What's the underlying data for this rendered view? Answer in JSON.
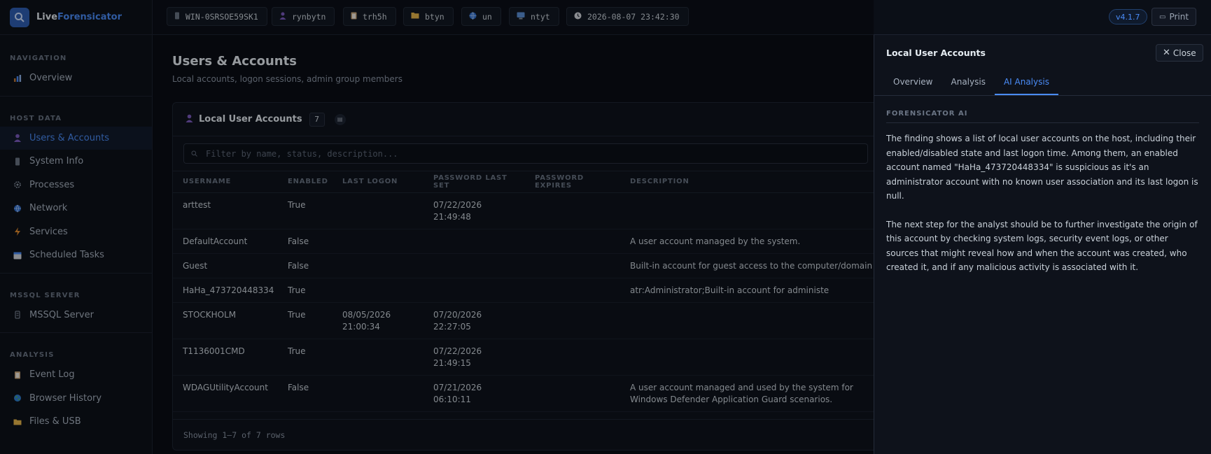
{
  "brand": {
    "name_part1": "Live",
    "name_part2": "Forensicator"
  },
  "sidebar": {
    "sections": [
      {
        "title": "NAVIGATION",
        "items": [
          {
            "label": "Overview",
            "icon": "chart-icon"
          }
        ]
      },
      {
        "title": "HOST DATA",
        "items": [
          {
            "label": "Users & Accounts",
            "icon": "user-icon",
            "active": true
          },
          {
            "label": "System Info",
            "icon": "device-icon"
          },
          {
            "label": "Processes",
            "icon": "gear-icon"
          },
          {
            "label": "Network",
            "icon": "globe-icon"
          },
          {
            "label": "Services",
            "icon": "bolt-icon"
          },
          {
            "label": "Scheduled Tasks",
            "icon": "calendar-icon"
          }
        ]
      },
      {
        "title": "MSSQL SERVER",
        "items": [
          {
            "label": "MSSQL Server",
            "icon": "database-icon"
          }
        ]
      },
      {
        "title": "ANALYSIS",
        "items": [
          {
            "label": "Event Log",
            "icon": "clipboard-icon"
          },
          {
            "label": "Browser History",
            "icon": "earth-icon"
          },
          {
            "label": "Files & USB",
            "icon": "folder-icon"
          }
        ]
      }
    ]
  },
  "topbar": {
    "chips": [
      {
        "icon": "device-icon",
        "text": "WIN-0SRSOE59SK1"
      },
      {
        "icon": "user-icon",
        "text": "rynbytn"
      },
      {
        "icon": "clipboard-icon",
        "text": "trh5h"
      },
      {
        "icon": "folder-icon",
        "text": "btyn"
      },
      {
        "icon": "globe-icon",
        "text": "un"
      },
      {
        "icon": "monitor-icon",
        "text": "ntyt"
      },
      {
        "icon": "clock-icon",
        "text": "2026-08-07 23:42:30"
      }
    ],
    "version": "v4.1.7",
    "print_label": "Print"
  },
  "main": {
    "title": "Users & Accounts",
    "subtitle": "Local accounts, logon sessions, admin group members",
    "card": {
      "title": "Local User Accounts",
      "count": "7",
      "filter_placeholder": "Filter by name, status, description...",
      "columns": [
        "USERNAME",
        "ENABLED",
        "LAST LOGON",
        "PASSWORD LAST SET",
        "PASSWORD EXPIRES",
        "DESCRIPTION"
      ],
      "rows": [
        {
          "username": "arttest",
          "enabled": "True",
          "last_logon": [
            "",
            ""
          ],
          "pwd_last_set": [
            "07/22/2026",
            "21:49:48"
          ],
          "pwd_expires": "",
          "description": ""
        },
        {
          "username": "DefaultAccount",
          "enabled": "False",
          "last_logon": [
            "",
            ""
          ],
          "pwd_last_set": [
            "",
            ""
          ],
          "pwd_expires": "",
          "description": "A user account managed by the system."
        },
        {
          "username": "Guest",
          "enabled": "False",
          "last_logon": [
            "",
            ""
          ],
          "pwd_last_set": [
            "",
            ""
          ],
          "pwd_expires": "",
          "description": "Built-in account for guest access to the computer/domain"
        },
        {
          "username": "HaHa_473720448334",
          "enabled": "True",
          "last_logon": [
            "",
            ""
          ],
          "pwd_last_set": [
            "",
            ""
          ],
          "pwd_expires": "",
          "description": "atr:Administrator;Built-in account for administe"
        },
        {
          "username": "STOCKHOLM",
          "enabled": "True",
          "last_logon": [
            "08/05/2026",
            "21:00:34"
          ],
          "pwd_last_set": [
            "07/20/2026",
            "22:27:05"
          ],
          "pwd_expires": "",
          "description": ""
        },
        {
          "username": "T1136001CMD",
          "enabled": "True",
          "last_logon": [
            "",
            ""
          ],
          "pwd_last_set": [
            "07/22/2026",
            "21:49:15"
          ],
          "pwd_expires": "",
          "description": ""
        },
        {
          "username": "WDAGUtilityAccount",
          "enabled": "False",
          "last_logon": [
            "",
            ""
          ],
          "pwd_last_set": [
            "07/21/2026",
            "06:10:11"
          ],
          "pwd_expires": "",
          "description": "A user account managed and used by the system for Windows Defender Application Guard scenarios."
        }
      ],
      "footer": "Showing 1–7 of 7 rows"
    }
  },
  "drawer": {
    "title": "Local User Accounts",
    "close_label": "Close",
    "tabs": [
      "Overview",
      "Analysis",
      "AI Analysis"
    ],
    "active_tab": "AI Analysis",
    "section_label": "FORENSICATOR AI",
    "paragraphs": [
      "The finding shows a list of local user accounts on the host, including their enabled/disabled state and last logon time. Among them, an enabled account named \"HaHa_473720448334\" is suspicious as it's an administrator account with no known user association and its last logon is null.",
      "The next step for the analyst should be to further investigate the origin of this account by checking system logs, security event logs, or other sources that might reveal how and when the account was created, who created it, and if any malicious activity is associated with it."
    ]
  },
  "colors": {
    "accent": "#4a8cf7",
    "background": "#0a0d14",
    "panel": "#0e121b"
  }
}
